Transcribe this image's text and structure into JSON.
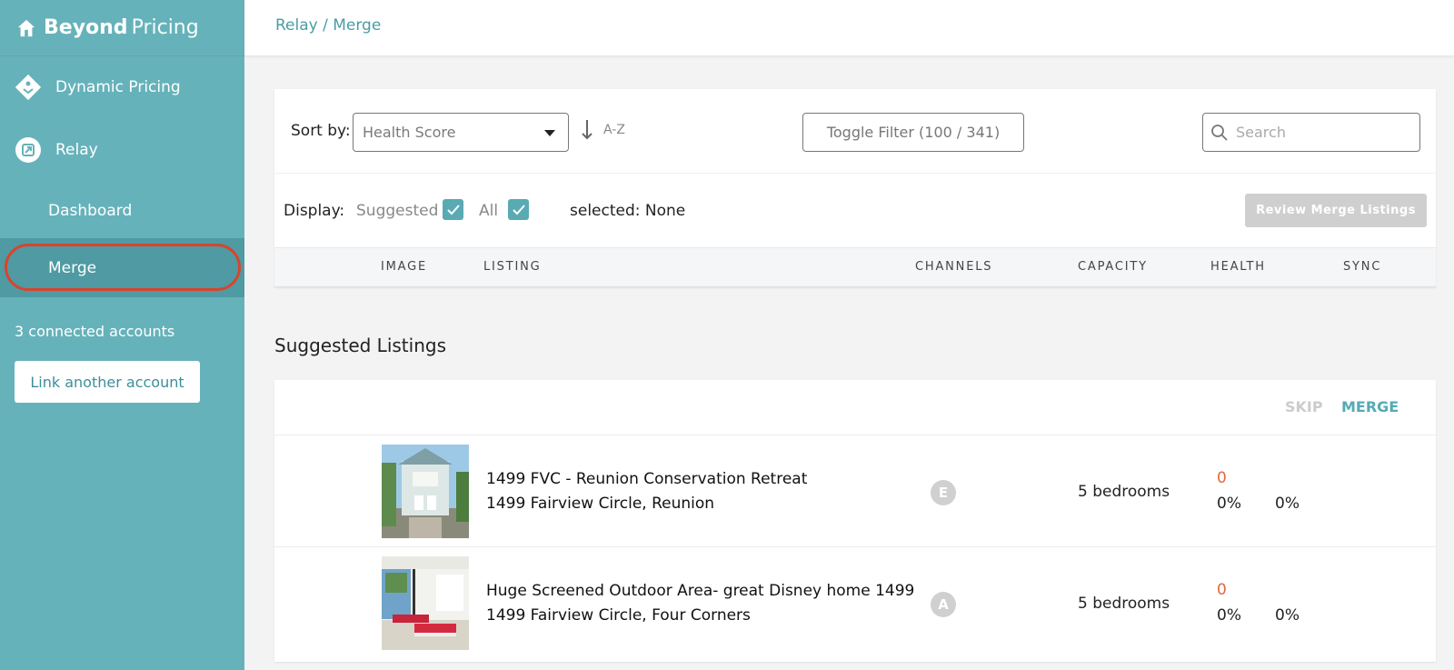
{
  "brand": {
    "bold": "Beyond",
    "light": "Pricing"
  },
  "sidebar": {
    "items": [
      {
        "label": "Dynamic Pricing"
      },
      {
        "label": "Relay"
      },
      {
        "label": "Dashboard"
      },
      {
        "label": "Merge"
      }
    ],
    "accounts_text": "3 connected accounts",
    "link_button": "Link another account"
  },
  "header": {
    "breadcrumb": "Relay / Merge"
  },
  "toolbar": {
    "sort_label": "Sort by:",
    "sort_value": "Health Score",
    "sort_direction": "A-Z",
    "toggle_filter": "Toggle Filter (100 / 341)",
    "search_placeholder": "Search"
  },
  "display": {
    "label": "Display:",
    "suggested": "Suggested",
    "all": "All",
    "selected": "selected: None",
    "review_button": "Review Merge Listings"
  },
  "columns": [
    "IMAGE",
    "LISTING",
    "CHANNELS",
    "CAPACITY",
    "HEALTH",
    "SYNC"
  ],
  "section_title": "Suggested Listings",
  "actions": {
    "skip": "SKIP",
    "merge": "MERGE"
  },
  "rows": [
    {
      "title": "1499 FVC - Reunion Conservation Retreat",
      "address": "1499 Fairview Circle, Reunion",
      "channel": "E",
      "capacity": "5 bedrooms",
      "health": "0",
      "pct1": "0%",
      "pct2": "0%"
    },
    {
      "title": "Huge Screened Outdoor Area- great Disney home 1499",
      "address": "1499 Fairview Circle, Four Corners",
      "channel": "A",
      "capacity": "5 bedrooms",
      "health": "0",
      "pct1": "0%",
      "pct2": "0%"
    }
  ],
  "colors": {
    "sidebar": "#66b2ba",
    "accent": "#4a9da6",
    "highlight_ring": "#d9442b",
    "health": "#e06a3d"
  }
}
